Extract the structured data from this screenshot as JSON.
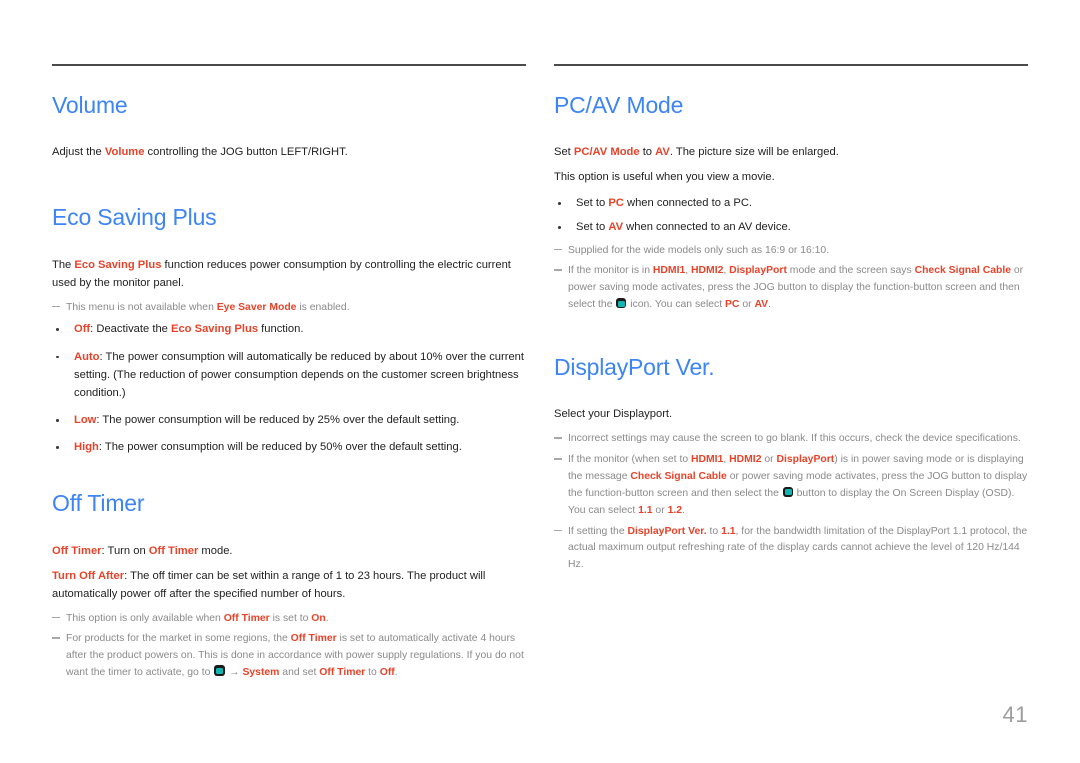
{
  "page": {
    "number": "41",
    "accent_blue": "#3d84f5",
    "accent_red": "#e8432a",
    "note_gray": "#8a8a8a",
    "osd_icon_name": "osd-menu-icon"
  },
  "left_column": {
    "sections": [
      {
        "title": "Volume",
        "body": [
          {
            "prefix": "Adjust the ",
            "hl1": "Volume",
            "suffix": " controlling the JOG button LEFT/RIGHT."
          }
        ]
      },
      {
        "title": "Eco Saving Plus",
        "intro": {
          "prefix": "The ",
          "hl1": "Eco Saving Plus",
          "suffix": " function reduces power consumption by controlling the electric current used by the monitor panel."
        },
        "note": {
          "prefix": "This menu is not available when ",
          "hl1": "Eye Saver Mode",
          "suffix": " is enabled."
        },
        "bullets": [
          {
            "label": "Off",
            "text_before": ": Deactivate the ",
            "hl2": "Eco Saving Plus",
            "text_after": " function."
          },
          {
            "label": "Auto",
            "text_before": ": The power consumption will automatically be reduced by about 10% over the current setting. (The reduction of power consumption depends on the customer screen brightness condition.)"
          },
          {
            "label": "Low",
            "text_before": ": The power consumption will be reduced by 25% over the default setting."
          },
          {
            "label": "High",
            "text_before": ": The power consumption will be reduced by 50% over the default setting."
          }
        ]
      },
      {
        "title": "Off Timer",
        "para1": {
          "hl1": "Off Timer",
          "mid": ": Turn on ",
          "hl2": "Off Timer",
          "suffix": " mode."
        },
        "para2": {
          "hl1": "Turn Off After",
          "suffix": ": The off timer can be set within a range of 1 to 23 hours. The product will automatically power off after the specified number of hours."
        },
        "note1": {
          "prefix": "This option is only available when ",
          "hl1": "Off Timer",
          "mid": " is set to ",
          "hl2": "On",
          "suffix": "."
        },
        "note2": {
          "p1": "For products for the market in some regions, the ",
          "hl1": "Off Timer",
          "p2": " is set to automatically activate 4 hours after the product powers on. This is done in accordance with power supply regulations. If you do not want the timer to activate, go to ",
          "arrow": "→ ",
          "hl2": "System",
          "p3": " and set ",
          "hl3": "Off Timer",
          "p4": " to ",
          "hl4": "Off",
          "p5": "."
        }
      }
    ]
  },
  "right_column": {
    "sections": [
      {
        "title": "PC/AV Mode",
        "para1": {
          "prefix": "Set ",
          "hl1": "PC/AV Mode",
          "mid": " to ",
          "hl2": "AV",
          "suffix": ". The picture size will be enlarged."
        },
        "para2": "This option is useful when you view a movie.",
        "bullets": [
          {
            "before": "Set to ",
            "hl": "PC",
            "after": " when connected to a PC."
          },
          {
            "before": "Set to ",
            "hl": "AV",
            "after": " when connected to an AV device."
          }
        ],
        "note1": "Supplied for the wide models only such as 16:9 or 16:10.",
        "note2": {
          "p1": "If the monitor is in ",
          "hl1": "HDMI1",
          "sep1": ", ",
          "hl2": "HDMI2",
          "sep2": ", ",
          "hl3": "DisplayPort",
          "p2": " mode and the screen says ",
          "hl4": "Check Signal Cable",
          "p3": " or power saving mode activates, press the JOG button to display the function-button screen and then select the ",
          "p4": " icon. You can select ",
          "hl5": "PC",
          "p5": " or ",
          "hl6": "AV",
          "p6": "."
        }
      },
      {
        "title": "DisplayPort Ver.",
        "para1": "Select your Displayport.",
        "note1": "Incorrect settings may cause the screen to go blank. If this occurs, check the device specifications.",
        "note2": {
          "p1": "If the monitor (when set to ",
          "hl1": "HDMI1",
          "sep1": ", ",
          "hl2": "HDMI2",
          "sep2": " or ",
          "hl3": "DisplayPort",
          "p2": ") is in power saving mode or is displaying the message ",
          "hl4": "Check Signal Cable",
          "p3": " or power saving mode activates, press the JOG button to display the function-button screen and then select the ",
          "p4": " button to display the On Screen Display (OSD). You can select ",
          "hl5": "1.1",
          "p5": " or ",
          "hl6": "1.2",
          "p6": "."
        },
        "note3": {
          "p1": "If setting the ",
          "hl1": "DisplayPort Ver.",
          "p2": " to ",
          "hl2": "1.1",
          "p3": ", for the bandwidth limitation of the DisplayPort 1.1 protocol, the actual maximum output refreshing rate of the display cards cannot achieve the level of 120 Hz/144 Hz."
        }
      }
    ]
  }
}
